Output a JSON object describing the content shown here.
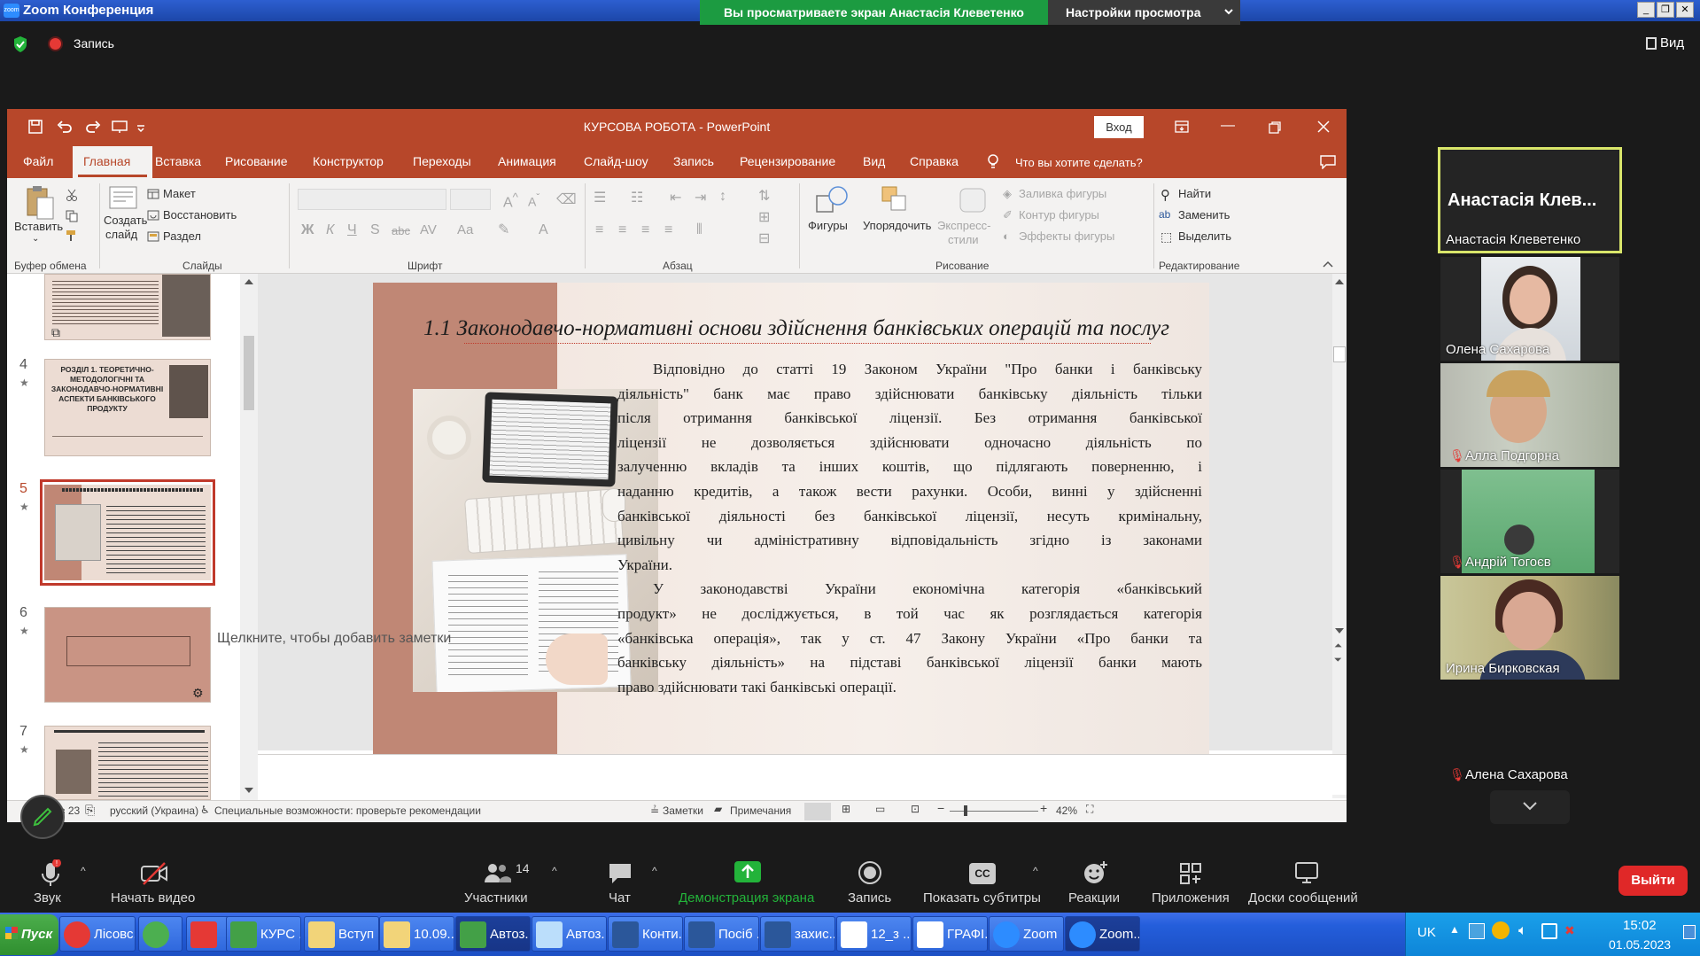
{
  "zoom": {
    "window_title": "Zoom Конференция",
    "logo_text": "zoom",
    "share_banner": "Вы просматриваете экран Анастасія Клеветенко",
    "view_settings": "Настройки просмотра",
    "record_label": "Запись",
    "view_button": "Вид"
  },
  "ppt": {
    "window_title": "КУРСОВА РОБОТА  -  PowerPoint",
    "signin": "Вход",
    "tabs": [
      "Файл",
      "Главная",
      "Вставка",
      "Рисование",
      "Конструктор",
      "Переходы",
      "Анимация",
      "Слайд-шоу",
      "Запись",
      "Рецензирование",
      "Вид",
      "Справка"
    ],
    "search_hint": "Что вы хотите сделать?",
    "ribbon": {
      "paste": "Вставить",
      "new_slide_1": "Создать",
      "new_slide_2": "слайд",
      "layout": "Макет",
      "reset": "Восстановить",
      "section": "Раздел",
      "shapes": "Фигуры",
      "arrange": "Упорядочить",
      "quick_styles_1": "Экспресс-",
      "quick_styles_2": "стили",
      "shape_fill": "Заливка фигуры",
      "shape_outline": "Контур фигуры",
      "shape_effects": "Эффекты фигуры",
      "find": "Найти",
      "replace": "Заменить",
      "select": "Выделить",
      "groups": [
        "Буфер обмена",
        "Слайды",
        "Шрифт",
        "Абзац",
        "Рисование",
        "Редактирование"
      ]
    },
    "thumbnails": [
      {
        "num": "",
        "title": ""
      },
      {
        "num": "4",
        "title": "РОЗДІЛ 1. ТЕОРЕТИЧНО-МЕТОДОЛОГІЧНІ ТА ЗАКОНОДАВЧО-НОРМАТИВНІ АСПЕКТИ БАНКІВСЬКОГО ПРОДУКТУ"
      },
      {
        "num": "5",
        "title": ""
      },
      {
        "num": "6",
        "title": ""
      },
      {
        "num": "7",
        "title": ""
      }
    ],
    "slide": {
      "title": "1.1  Законодавчо-нормативні основи здійснення банківських операцій та послуг",
      "p1": [
        "Відповідно до статті 19 Законом України \"Про банки і банківську",
        "діяльність\" банк має право здійснювати банківську діяльність тільки",
        "після отримання банківської ліцензії. Без отримання банківської",
        "ліцензії не дозволяється здійснювати одночасно діяльність по",
        "залученню вкладів та інших коштів, що підлягають поверненню, і",
        "наданню кредитів, а також вести рахунки. Особи, винні у здійсненні",
        "банківської діяльності без банківської ліцензії, несуть кримінальну,",
        "цивільну чи адміністративну відповідальність згідно із законами",
        "України."
      ],
      "p2": [
        "У законодавстві України економічна категорія «банківський",
        "продукт» не досліджується, в той час як розглядається категорія",
        "«банківська операція», так у ст. 47 Закону України «Про банки та",
        "банківську діяльність» на підставі банківської ліцензії банки мають",
        "право здійснювати такі банківські операції."
      ]
    },
    "notes_placeholder": "Щелкните, чтобы добавить заметки",
    "status": {
      "slide_of": "Слайд 5 из 23",
      "slide_total": "з 23",
      "language": "русский (Украина)",
      "accessibility": "Специальные возможности: проверьте рекомендации",
      "notes": "Заметки",
      "comments": "Примечания",
      "zoom": "42%"
    }
  },
  "participants": [
    {
      "name": "Анастасія Клеветенко",
      "big_name": "Анастасія  Клев...",
      "muted": false,
      "active": true
    },
    {
      "name": "Олена Сахарова",
      "muted": false
    },
    {
      "name": "Алла Подгорна",
      "muted": true
    },
    {
      "name": "Андрій Тогоєв",
      "muted": true
    },
    {
      "name": "Ирина Бирковская",
      "muted": false
    },
    {
      "name": "Алена Сахарова",
      "muted": true
    }
  ],
  "toolbar": {
    "audio": "Звук",
    "video": "Начать видео",
    "participants": "Участники",
    "participants_count": "14",
    "chat": "Чат",
    "share": "Демонстрация экрана",
    "record": "Запись",
    "captions": "Показать субтитры",
    "reactions": "Реакции",
    "apps": "Приложения",
    "whiteboards": "Доски сообщений",
    "leave": "Выйти"
  },
  "taskbar": {
    "start": "Пуск",
    "items": [
      "Лісовс...",
      "",
      "",
      "КУРС ...",
      "Вступ",
      "10.09....",
      "Автоз...",
      "Автоз...",
      "Конти...",
      "Посіб ...",
      "захис...",
      "12_з ...",
      "ГРАФІ...",
      "Zoom",
      "Zoom..."
    ],
    "lang": "UK",
    "time": "15:02",
    "date": "01.05.2023"
  },
  "colors": {
    "ppt_accent": "#b7472a",
    "zoom_green": "#1c9b41",
    "leave_red": "#e02828",
    "slide_band": "#c08775"
  }
}
